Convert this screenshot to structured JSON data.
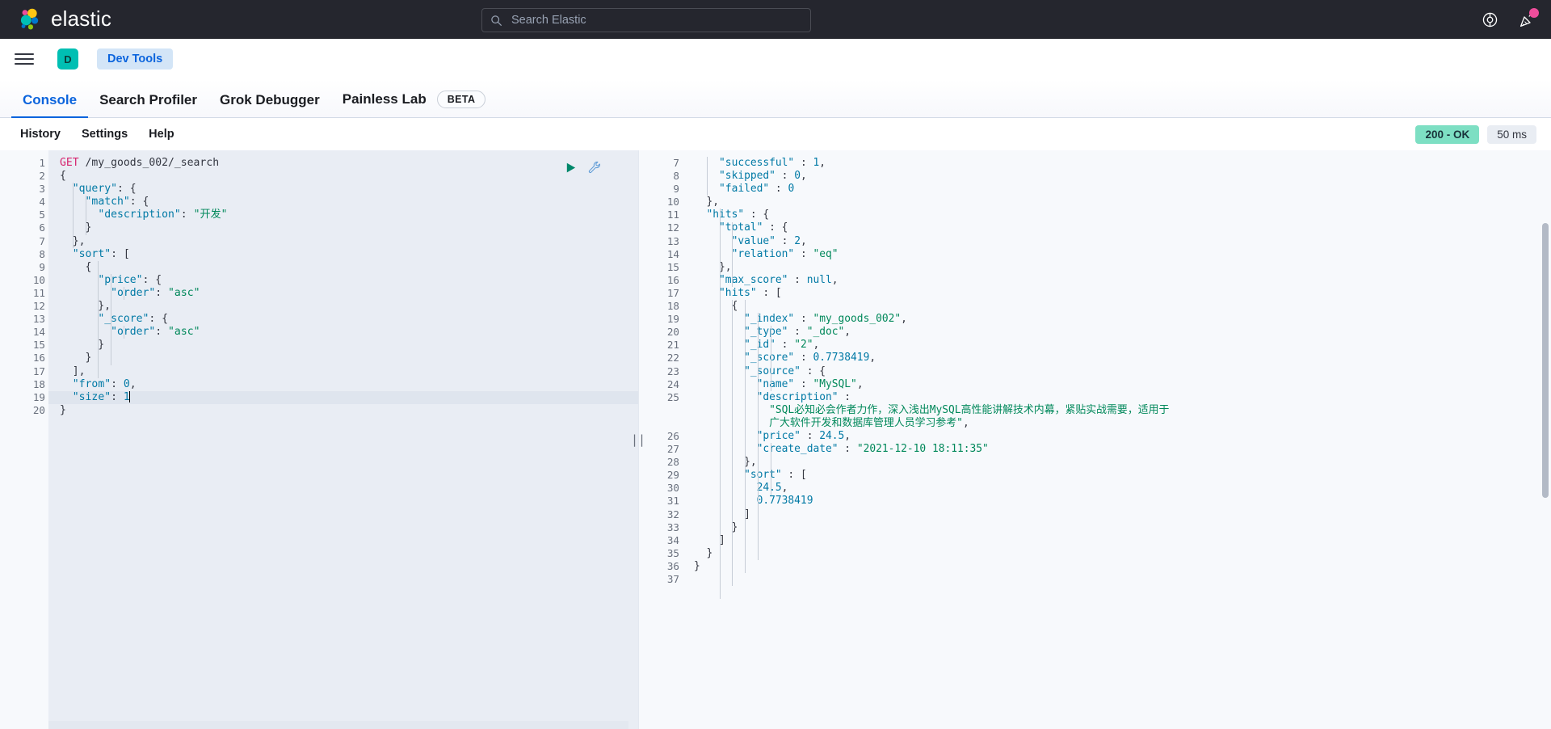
{
  "header": {
    "brand_name": "elastic",
    "search_placeholder": "Search Elastic",
    "search_value": "",
    "help_icon": "lifebuoy-icon",
    "announcement_icon": "party-popper-icon"
  },
  "breadcrumb": {
    "menu_icon": "hamburger-menu-icon",
    "space_initial": "D",
    "crumb_label": "Dev Tools"
  },
  "tabs": [
    {
      "label": "Console",
      "active": true,
      "badge": ""
    },
    {
      "label": "Search Profiler",
      "active": false,
      "badge": ""
    },
    {
      "label": "Grok Debugger",
      "active": false,
      "badge": ""
    },
    {
      "label": "Painless Lab",
      "active": false,
      "badge": "BETA"
    }
  ],
  "console_toolbar": {
    "links": [
      "History",
      "Settings",
      "Help"
    ],
    "status_code": "200 - OK",
    "status_time": "50 ms"
  },
  "request_editor": {
    "play_icon": "play-triangle-icon",
    "wrench_icon": "wrench-icon",
    "caret_line": 19,
    "lines": [
      {
        "n": 1,
        "fold": "",
        "tokens": [
          {
            "t": "GET",
            "c": "k-method"
          },
          {
            "t": " /my_goods_002/_search",
            "c": "k-url"
          }
        ]
      },
      {
        "n": 2,
        "fold": "▾",
        "tokens": [
          {
            "t": "{",
            "c": "k-punc"
          }
        ]
      },
      {
        "n": 3,
        "fold": "▾",
        "tokens": [
          {
            "t": "  ",
            "c": "k-punc"
          },
          {
            "t": "\"query\"",
            "c": "k-key"
          },
          {
            "t": ": {",
            "c": "k-punc"
          }
        ]
      },
      {
        "n": 4,
        "fold": "▾",
        "tokens": [
          {
            "t": "    ",
            "c": "k-punc"
          },
          {
            "t": "\"match\"",
            "c": "k-key"
          },
          {
            "t": ": {",
            "c": "k-punc"
          }
        ]
      },
      {
        "n": 5,
        "fold": "",
        "tokens": [
          {
            "t": "      ",
            "c": "k-punc"
          },
          {
            "t": "\"description\"",
            "c": "k-key"
          },
          {
            "t": ": ",
            "c": "k-punc"
          },
          {
            "t": "\"开发\"",
            "c": "k-str"
          }
        ]
      },
      {
        "n": 6,
        "fold": "▴",
        "tokens": [
          {
            "t": "    }",
            "c": "k-punc"
          }
        ]
      },
      {
        "n": 7,
        "fold": "▴",
        "tokens": [
          {
            "t": "  },",
            "c": "k-punc"
          }
        ]
      },
      {
        "n": 8,
        "fold": "▾",
        "tokens": [
          {
            "t": "  ",
            "c": "k-punc"
          },
          {
            "t": "\"sort\"",
            "c": "k-key"
          },
          {
            "t": ": [",
            "c": "k-punc"
          }
        ]
      },
      {
        "n": 9,
        "fold": "▾",
        "tokens": [
          {
            "t": "    {",
            "c": "k-punc"
          }
        ]
      },
      {
        "n": 10,
        "fold": "▾",
        "tokens": [
          {
            "t": "      ",
            "c": "k-punc"
          },
          {
            "t": "\"price\"",
            "c": "k-key"
          },
          {
            "t": ": {",
            "c": "k-punc"
          }
        ]
      },
      {
        "n": 11,
        "fold": "",
        "tokens": [
          {
            "t": "        ",
            "c": "k-punc"
          },
          {
            "t": "\"order\"",
            "c": "k-key"
          },
          {
            "t": ": ",
            "c": "k-punc"
          },
          {
            "t": "\"asc\"",
            "c": "k-str"
          }
        ]
      },
      {
        "n": 12,
        "fold": "▴",
        "tokens": [
          {
            "t": "      },",
            "c": "k-punc"
          }
        ]
      },
      {
        "n": 13,
        "fold": "▾",
        "tokens": [
          {
            "t": "      ",
            "c": "k-punc"
          },
          {
            "t": "\"_score\"",
            "c": "k-key"
          },
          {
            "t": ": {",
            "c": "k-punc"
          }
        ]
      },
      {
        "n": 14,
        "fold": "",
        "tokens": [
          {
            "t": "        ",
            "c": "k-punc"
          },
          {
            "t": "\"order\"",
            "c": "k-key"
          },
          {
            "t": ": ",
            "c": "k-punc"
          },
          {
            "t": "\"asc\"",
            "c": "k-str"
          }
        ]
      },
      {
        "n": 15,
        "fold": "▴",
        "tokens": [
          {
            "t": "      }",
            "c": "k-punc"
          }
        ]
      },
      {
        "n": 16,
        "fold": "▴",
        "tokens": [
          {
            "t": "    }",
            "c": "k-punc"
          }
        ]
      },
      {
        "n": 17,
        "fold": "▴",
        "tokens": [
          {
            "t": "  ],",
            "c": "k-punc"
          }
        ]
      },
      {
        "n": 18,
        "fold": "",
        "tokens": [
          {
            "t": "  ",
            "c": "k-punc"
          },
          {
            "t": "\"from\"",
            "c": "k-key"
          },
          {
            "t": ": ",
            "c": "k-punc"
          },
          {
            "t": "0",
            "c": "k-num"
          },
          {
            "t": ",",
            "c": "k-punc"
          }
        ]
      },
      {
        "n": 19,
        "fold": "",
        "tokens": [
          {
            "t": "  ",
            "c": "k-punc"
          },
          {
            "t": "\"size\"",
            "c": "k-key"
          },
          {
            "t": ": ",
            "c": "k-punc"
          },
          {
            "t": "1",
            "c": "k-num"
          }
        ]
      },
      {
        "n": 20,
        "fold": "▴",
        "tokens": [
          {
            "t": "}",
            "c": "k-punc"
          }
        ]
      }
    ]
  },
  "response_editor": {
    "lines": [
      {
        "n": 7,
        "fold": "",
        "tokens": [
          {
            "t": "    ",
            "c": "k-punc"
          },
          {
            "t": "\"successful\"",
            "c": "k-key"
          },
          {
            "t": " : ",
            "c": "k-punc"
          },
          {
            "t": "1",
            "c": "k-num"
          },
          {
            "t": ",",
            "c": "k-punc"
          }
        ]
      },
      {
        "n": 8,
        "fold": "",
        "tokens": [
          {
            "t": "    ",
            "c": "k-punc"
          },
          {
            "t": "\"skipped\"",
            "c": "k-key"
          },
          {
            "t": " : ",
            "c": "k-punc"
          },
          {
            "t": "0",
            "c": "k-num"
          },
          {
            "t": ",",
            "c": "k-punc"
          }
        ]
      },
      {
        "n": 9,
        "fold": "",
        "tokens": [
          {
            "t": "    ",
            "c": "k-punc"
          },
          {
            "t": "\"failed\"",
            "c": "k-key"
          },
          {
            "t": " : ",
            "c": "k-punc"
          },
          {
            "t": "0",
            "c": "k-num"
          }
        ]
      },
      {
        "n": 10,
        "fold": "▴",
        "tokens": [
          {
            "t": "  },",
            "c": "k-punc"
          }
        ]
      },
      {
        "n": 11,
        "fold": "▾",
        "tokens": [
          {
            "t": "  ",
            "c": "k-punc"
          },
          {
            "t": "\"hits\"",
            "c": "k-key"
          },
          {
            "t": " : {",
            "c": "k-punc"
          }
        ]
      },
      {
        "n": 12,
        "fold": "▾",
        "tokens": [
          {
            "t": "    ",
            "c": "k-punc"
          },
          {
            "t": "\"total\"",
            "c": "k-key"
          },
          {
            "t": " : {",
            "c": "k-punc"
          }
        ]
      },
      {
        "n": 13,
        "fold": "",
        "tokens": [
          {
            "t": "      ",
            "c": "k-punc"
          },
          {
            "t": "\"value\"",
            "c": "k-key"
          },
          {
            "t": " : ",
            "c": "k-punc"
          },
          {
            "t": "2",
            "c": "k-num"
          },
          {
            "t": ",",
            "c": "k-punc"
          }
        ]
      },
      {
        "n": 14,
        "fold": "",
        "tokens": [
          {
            "t": "      ",
            "c": "k-punc"
          },
          {
            "t": "\"relation\"",
            "c": "k-key"
          },
          {
            "t": " : ",
            "c": "k-punc"
          },
          {
            "t": "\"eq\"",
            "c": "k-str"
          }
        ]
      },
      {
        "n": 15,
        "fold": "▴",
        "tokens": [
          {
            "t": "    },",
            "c": "k-punc"
          }
        ]
      },
      {
        "n": 16,
        "fold": "",
        "tokens": [
          {
            "t": "    ",
            "c": "k-punc"
          },
          {
            "t": "\"max_score\"",
            "c": "k-key"
          },
          {
            "t": " : ",
            "c": "k-punc"
          },
          {
            "t": "null",
            "c": "k-null"
          },
          {
            "t": ",",
            "c": "k-punc"
          }
        ]
      },
      {
        "n": 17,
        "fold": "▾",
        "tokens": [
          {
            "t": "    ",
            "c": "k-punc"
          },
          {
            "t": "\"hits\"",
            "c": "k-key"
          },
          {
            "t": " : [",
            "c": "k-punc"
          }
        ]
      },
      {
        "n": 18,
        "fold": "▾",
        "tokens": [
          {
            "t": "      {",
            "c": "k-punc"
          }
        ]
      },
      {
        "n": 19,
        "fold": "",
        "tokens": [
          {
            "t": "        ",
            "c": "k-punc"
          },
          {
            "t": "\"_index\"",
            "c": "k-key"
          },
          {
            "t": " : ",
            "c": "k-punc"
          },
          {
            "t": "\"my_goods_002\"",
            "c": "k-str"
          },
          {
            "t": ",",
            "c": "k-punc"
          }
        ]
      },
      {
        "n": 20,
        "fold": "",
        "tokens": [
          {
            "t": "        ",
            "c": "k-punc"
          },
          {
            "t": "\"_type\"",
            "c": "k-key"
          },
          {
            "t": " : ",
            "c": "k-punc"
          },
          {
            "t": "\"_doc\"",
            "c": "k-str"
          },
          {
            "t": ",",
            "c": "k-punc"
          }
        ]
      },
      {
        "n": 21,
        "fold": "",
        "tokens": [
          {
            "t": "        ",
            "c": "k-punc"
          },
          {
            "t": "\"_id\"",
            "c": "k-key"
          },
          {
            "t": " : ",
            "c": "k-punc"
          },
          {
            "t": "\"2\"",
            "c": "k-str"
          },
          {
            "t": ",",
            "c": "k-punc"
          }
        ]
      },
      {
        "n": 22,
        "fold": "",
        "tokens": [
          {
            "t": "        ",
            "c": "k-punc"
          },
          {
            "t": "\"_score\"",
            "c": "k-key"
          },
          {
            "t": " : ",
            "c": "k-punc"
          },
          {
            "t": "0.7738419",
            "c": "k-num"
          },
          {
            "t": ",",
            "c": "k-punc"
          }
        ]
      },
      {
        "n": 23,
        "fold": "▾",
        "tokens": [
          {
            "t": "        ",
            "c": "k-punc"
          },
          {
            "t": "\"_source\"",
            "c": "k-key"
          },
          {
            "t": " : {",
            "c": "k-punc"
          }
        ]
      },
      {
        "n": 24,
        "fold": "",
        "tokens": [
          {
            "t": "          ",
            "c": "k-punc"
          },
          {
            "t": "\"name\"",
            "c": "k-key"
          },
          {
            "t": " : ",
            "c": "k-punc"
          },
          {
            "t": "\"MySQL\"",
            "c": "k-str"
          },
          {
            "t": ",",
            "c": "k-punc"
          }
        ]
      },
      {
        "n": 25,
        "fold": "",
        "tokens": [
          {
            "t": "          ",
            "c": "k-punc"
          },
          {
            "t": "\"description\"",
            "c": "k-key"
          },
          {
            "t": " :",
            "c": "k-punc"
          }
        ]
      },
      {
        "n": "",
        "fold": "",
        "tokens": [
          {
            "t": "            ",
            "c": "k-punc"
          },
          {
            "t": "\"SQL必知必会作者力作，深入浅出MySQL高性能讲解技术内幕，紧贴实战需要，适用于",
            "c": "k-str"
          }
        ]
      },
      {
        "n": "",
        "fold": "",
        "tokens": [
          {
            "t": "            ",
            "c": "k-punc"
          },
          {
            "t": "广大软件开发和数据库管理人员学习参考\"",
            "c": "k-str"
          },
          {
            "t": ",",
            "c": "k-punc"
          }
        ]
      },
      {
        "n": 26,
        "fold": "",
        "tokens": [
          {
            "t": "          ",
            "c": "k-punc"
          },
          {
            "t": "\"price\"",
            "c": "k-key"
          },
          {
            "t": " : ",
            "c": "k-punc"
          },
          {
            "t": "24.5",
            "c": "k-num"
          },
          {
            "t": ",",
            "c": "k-punc"
          }
        ]
      },
      {
        "n": 27,
        "fold": "",
        "tokens": [
          {
            "t": "          ",
            "c": "k-punc"
          },
          {
            "t": "\"create_date\"",
            "c": "k-key"
          },
          {
            "t": " : ",
            "c": "k-punc"
          },
          {
            "t": "\"2021-12-10 18:11:35\"",
            "c": "k-str"
          }
        ]
      },
      {
        "n": 28,
        "fold": "▴",
        "tokens": [
          {
            "t": "        },",
            "c": "k-punc"
          }
        ]
      },
      {
        "n": 29,
        "fold": "▾",
        "tokens": [
          {
            "t": "        ",
            "c": "k-punc"
          },
          {
            "t": "\"sort\"",
            "c": "k-key"
          },
          {
            "t": " : [",
            "c": "k-punc"
          }
        ]
      },
      {
        "n": 30,
        "fold": "",
        "tokens": [
          {
            "t": "          ",
            "c": "k-punc"
          },
          {
            "t": "24.5",
            "c": "k-num"
          },
          {
            "t": ",",
            "c": "k-punc"
          }
        ]
      },
      {
        "n": 31,
        "fold": "",
        "tokens": [
          {
            "t": "          ",
            "c": "k-punc"
          },
          {
            "t": "0.7738419",
            "c": "k-num"
          }
        ]
      },
      {
        "n": 32,
        "fold": "▴",
        "tokens": [
          {
            "t": "        ]",
            "c": "k-punc"
          }
        ]
      },
      {
        "n": 33,
        "fold": "▴",
        "tokens": [
          {
            "t": "      }",
            "c": "k-punc"
          }
        ]
      },
      {
        "n": 34,
        "fold": "▴",
        "tokens": [
          {
            "t": "    ]",
            "c": "k-punc"
          }
        ]
      },
      {
        "n": 35,
        "fold": "▴",
        "tokens": [
          {
            "t": "  }",
            "c": "k-punc"
          }
        ]
      },
      {
        "n": 36,
        "fold": "▴",
        "tokens": [
          {
            "t": "}",
            "c": "k-punc"
          }
        ]
      },
      {
        "n": 37,
        "fold": "",
        "tokens": [
          {
            "t": "",
            "c": "k-punc"
          }
        ]
      }
    ]
  },
  "colors": {
    "header_bg": "#25262e",
    "accent_blue": "#0b64dd",
    "teal": "#00bfb3",
    "status_ok_bg": "#7ddfc3",
    "notif_pink": "#ee4d9b",
    "request_bg": "#e9edf4",
    "response_bg": "#f7f9fc"
  }
}
